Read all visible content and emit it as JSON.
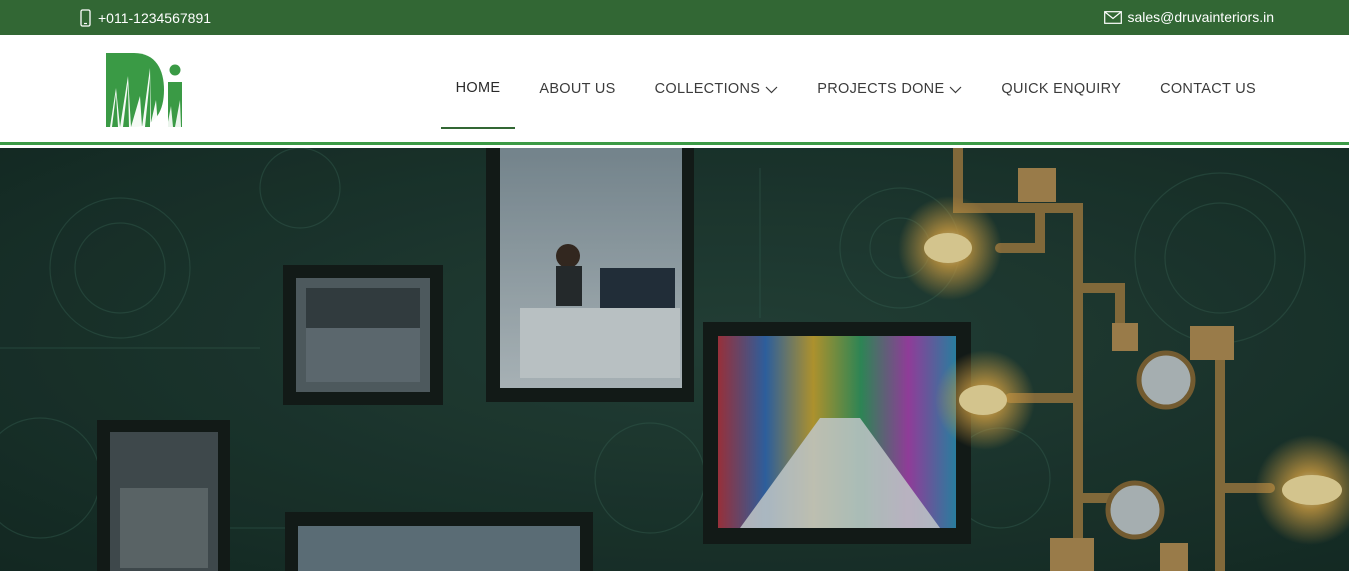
{
  "topbar": {
    "phone": "+011-1234567891",
    "email": "sales@druvainteriors.in",
    "phone_icon": "mobile-phone-icon",
    "email_icon": "envelope-icon"
  },
  "brand": {
    "logo_icon": "druva-interiors-logo",
    "logo_text": "Di",
    "colors": {
      "topbar": "#326734",
      "accent": "#3c9a46",
      "logo_green": "#3a9a45"
    }
  },
  "nav": {
    "items": [
      {
        "label": "HOME",
        "active": true
      },
      {
        "label": "ABOUT US"
      },
      {
        "label": "COLLECTIONS",
        "dropdown": true
      },
      {
        "label": "PROJECTS DONE",
        "dropdown": true
      },
      {
        "label": "QUICK ENQUIRY"
      },
      {
        "label": "CONTACT US"
      }
    ]
  },
  "hero": {
    "description_icon": "hero-banner-image",
    "theme": "dark green wall with framed office interior photos and vintage pipe lamps"
  }
}
